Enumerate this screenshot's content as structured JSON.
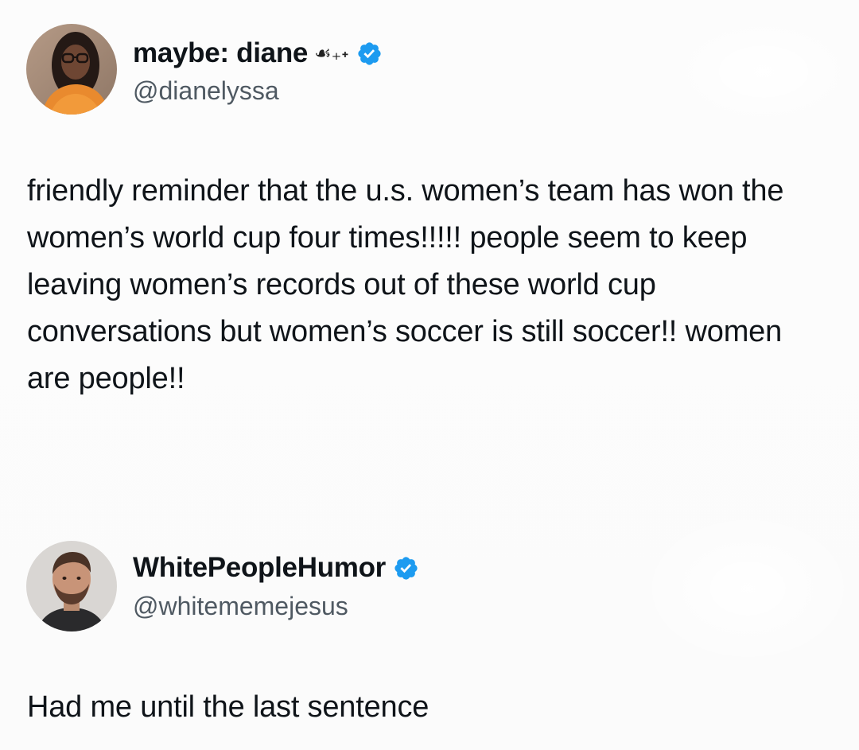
{
  "colors": {
    "background": "#fdfdfd",
    "text": "#0f1419",
    "handle": "#4f5962",
    "verified_badge": "#1d9bf0"
  },
  "tweets": [
    {
      "display_name": "maybe: diane",
      "name_decoration": "☙₊˖",
      "handle": "@dianelyssa",
      "verified": true,
      "avatar_icon": "avatar-photo-woman",
      "text": "friendly reminder that the u.s. women’s team has won the women’s world cup four times!!!!! people seem to keep leaving women’s records out of these world cup conversations but women’s soccer is still soccer!! women are people!!"
    },
    {
      "display_name": "WhitePeopleHumor",
      "handle": "@whitememejesus",
      "verified": true,
      "avatar_icon": "avatar-photo-man",
      "text": "Had me until the last sentence"
    }
  ]
}
